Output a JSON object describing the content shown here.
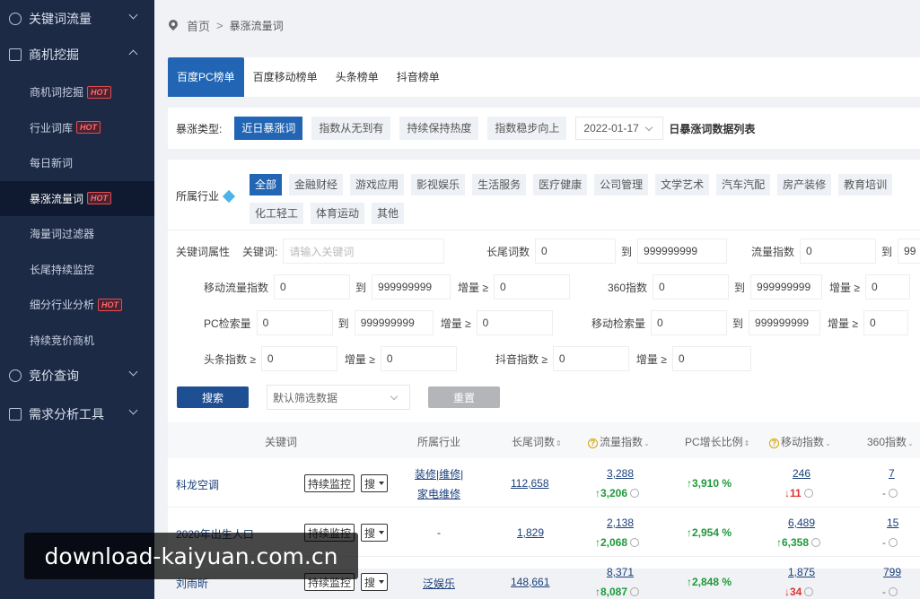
{
  "sidebar": {
    "groups": [
      {
        "label": "关键词流量",
        "icon": "target-icon"
      },
      {
        "label": "商机挖掘",
        "icon": "calendar-icon"
      },
      {
        "label": "竞价查询",
        "icon": "registered-icon"
      },
      {
        "label": "需求分析工具",
        "icon": "document-icon"
      }
    ],
    "sub_items": [
      {
        "label": "商机词挖掘",
        "hot": "HOT"
      },
      {
        "label": "行业词库",
        "hot": "HOT"
      },
      {
        "label": "每日新词",
        "hot": ""
      },
      {
        "label": "暴涨流量词",
        "hot": "HOT"
      },
      {
        "label": "海量词过滤器",
        "hot": ""
      },
      {
        "label": "长尾持续监控",
        "hot": ""
      },
      {
        "label": "细分行业分析",
        "hot": "HOT"
      },
      {
        "label": "持续竞价商机",
        "hot": ""
      }
    ]
  },
  "breadcrumb": {
    "home": "首页",
    "sep": ">",
    "current": "暴涨流量词"
  },
  "tabs": [
    "百度PC榜单",
    "百度移动榜单",
    "头条榜单",
    "抖音榜单"
  ],
  "filter": {
    "type_label": "暴涨类型:",
    "types": [
      "近日暴涨词",
      "指数从无到有",
      "持续保持热度",
      "指数稳步向上"
    ],
    "date": "2022-01-17",
    "date_suffix": "日暴涨词数据列表"
  },
  "industry": {
    "label": "所属行业",
    "chips": [
      "全部",
      "金融财经",
      "游戏应用",
      "影视娱乐",
      "生活服务",
      "医疗健康",
      "公司管理",
      "文学艺术",
      "汽车汽配",
      "房产装修",
      "教育培训",
      "化工轻工",
      "体育运动",
      "其他"
    ]
  },
  "attrs": {
    "label": "关键词属性",
    "kw_label": "关键词:",
    "kw_placeholder": "请输入关键词",
    "longtail_label": "长尾词数",
    "to": "到",
    "zero": "0",
    "max": "999999999",
    "flow_label": "流量指数",
    "flow_max_partial": "99",
    "mobile_flow_label": "移动流量指数",
    "inc_label": "增量 ≥",
    "idx360_label": "360指数",
    "pc_search_label": "PC检索量",
    "mobile_search_label": "移动检索量",
    "toutiao_label": "头条指数 ≥",
    "douyin_label": "抖音指数 ≥"
  },
  "actions": {
    "search": "搜索",
    "default_filter": "默认筛选数据",
    "reset": "重置"
  },
  "table": {
    "headers": {
      "keyword": "关键词",
      "industry": "所属行业",
      "longtail": "长尾词数",
      "flow": "流量指数",
      "pc_growth": "PC增长比例",
      "mobile": "移动指数",
      "idx360": "360指数"
    },
    "monitor_label": "持续监控",
    "search_label": "搜",
    "rows": [
      {
        "keyword": "科龙空调",
        "industry1": "装修|维修|",
        "industry2": "家电维修",
        "longtail": "112,658",
        "flow": "3,288",
        "flow_inc": "3,206",
        "pc_growth": "3,910 %",
        "mobile": "246",
        "mobile_inc": "11",
        "mobile_dir": "down",
        "idx360": "7",
        "idx360_inc": "-"
      },
      {
        "keyword": "2020年出生人口",
        "industry1": "-",
        "industry2": "",
        "longtail": "1,829",
        "flow": "2,138",
        "flow_inc": "2,068",
        "pc_growth": "2,954 %",
        "mobile": "6,489",
        "mobile_inc": "6,358",
        "mobile_dir": "up",
        "idx360": "15",
        "idx360_inc": "-"
      },
      {
        "keyword": "刘雨昕",
        "industry1": "泛娱乐",
        "industry2": "",
        "longtail": "148,661",
        "flow": "8,371",
        "flow_inc": "8,087",
        "pc_growth": "2,848 %",
        "mobile": "1,875",
        "mobile_inc": "34",
        "mobile_dir": "down",
        "idx360": "799",
        "idx360_inc": "-"
      }
    ]
  },
  "watermark": "download-kaiyuan.com.cn"
}
